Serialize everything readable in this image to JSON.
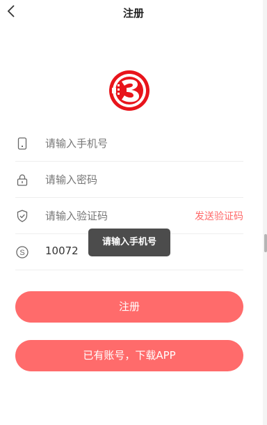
{
  "header": {
    "title": "注册"
  },
  "form": {
    "phone_placeholder": "请输入手机号",
    "password_placeholder": "请输入密码",
    "code_placeholder": "请输入验证码",
    "send_code_label": "发送验证码",
    "invite_value": "10072"
  },
  "toast": {
    "message": "请输入手机号"
  },
  "buttons": {
    "register_label": "注册",
    "download_label": "已有账号，下载APP"
  },
  "colors": {
    "accent": "#ff6b6b",
    "logo_red": "#e8141b",
    "toast_bg": "#4c4c4c"
  },
  "icons": {
    "back": "chevron-left-icon",
    "phone": "phone-icon",
    "lock": "lock-icon",
    "shield": "shield-icon",
    "invite": "s-circle-icon"
  }
}
